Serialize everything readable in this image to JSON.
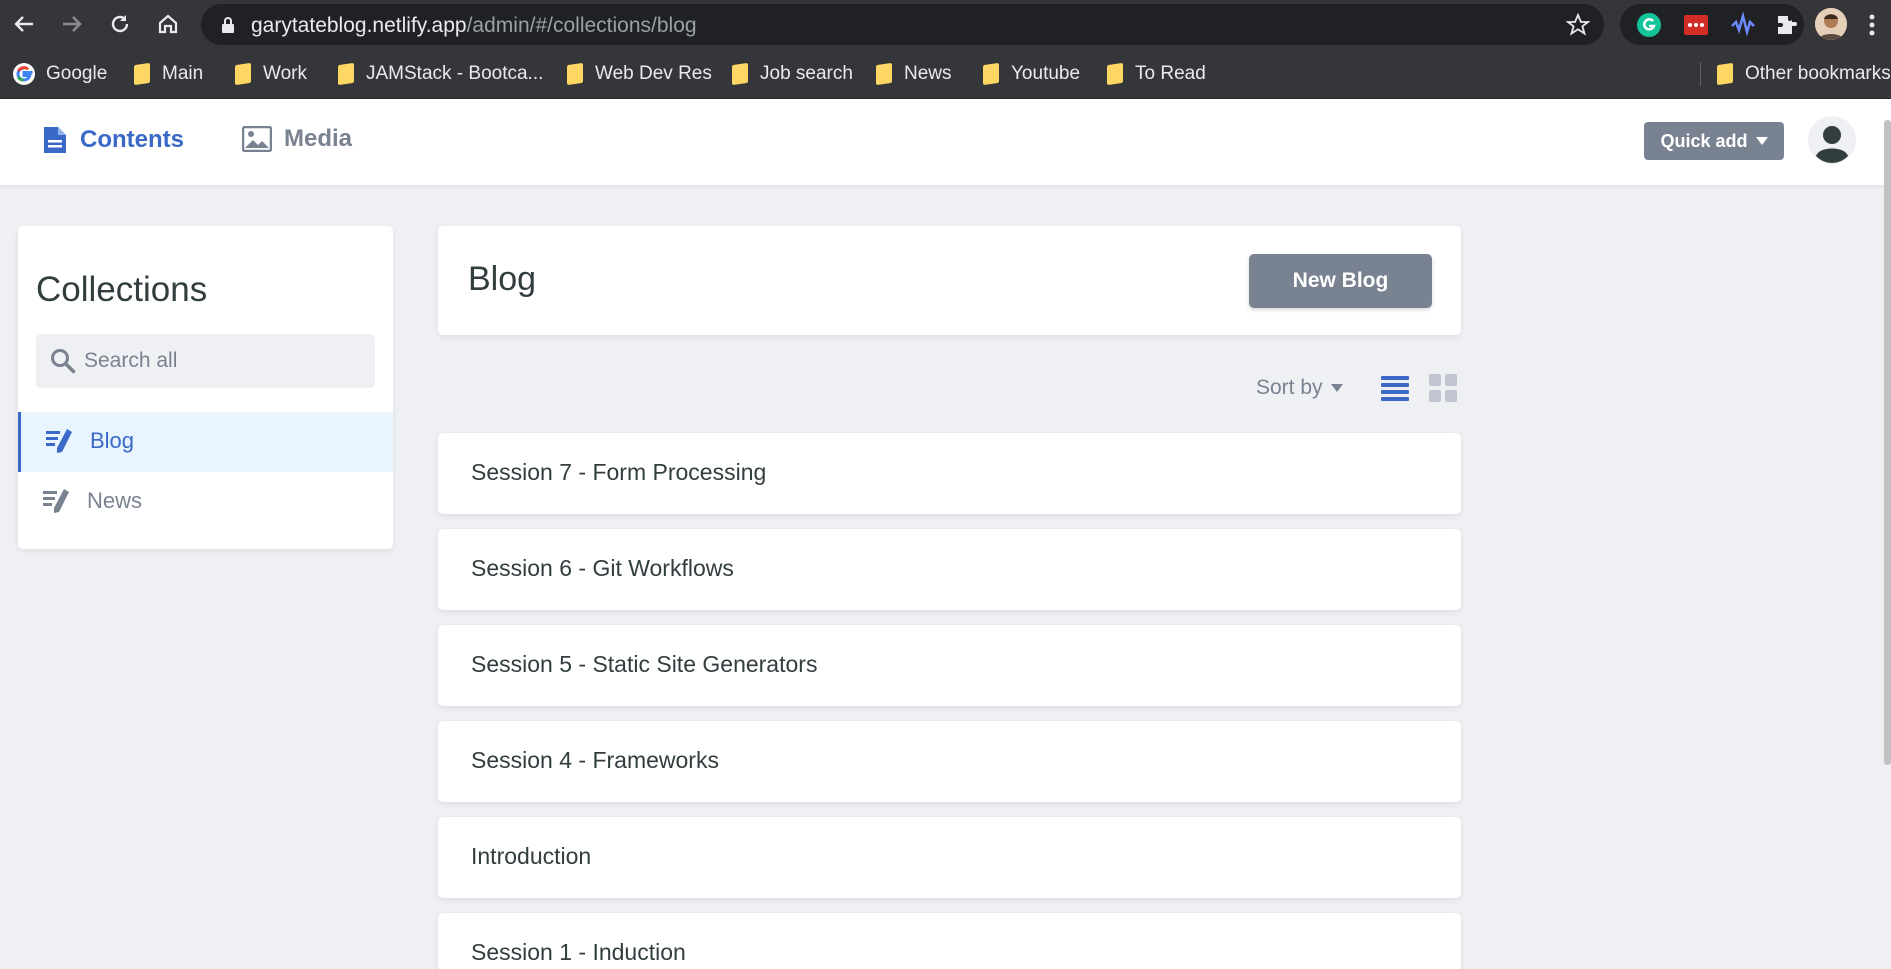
{
  "browser": {
    "url_host": "garytateblog.netlify.app",
    "url_path": "/admin/#/collections/blog",
    "bookmarks": [
      {
        "label": "Google",
        "icon": "google-icon"
      },
      {
        "label": "Main",
        "icon": "folder-icon"
      },
      {
        "label": "Work",
        "icon": "folder-icon"
      },
      {
        "label": "JAMStack - Bootca...",
        "icon": "folder-icon"
      },
      {
        "label": "Web Dev Res",
        "icon": "folder-icon"
      },
      {
        "label": "Job search",
        "icon": "folder-icon"
      },
      {
        "label": "News",
        "icon": "folder-icon"
      },
      {
        "label": "Youtube",
        "icon": "folder-icon"
      },
      {
        "label": "To Read",
        "icon": "folder-icon"
      }
    ],
    "other_bookmarks": "Other bookmarks"
  },
  "header": {
    "tabs": [
      {
        "label": "Contents",
        "icon": "document-icon",
        "active": true
      },
      {
        "label": "Media",
        "icon": "image-icon",
        "active": false
      }
    ],
    "quick_add": "Quick add"
  },
  "sidebar": {
    "title": "Collections",
    "search_placeholder": "Search all",
    "items": [
      {
        "label": "Blog",
        "icon": "write-icon",
        "active": true
      },
      {
        "label": "News",
        "icon": "write-icon",
        "active": false
      }
    ]
  },
  "main": {
    "collection_title": "Blog",
    "new_button": "New Blog",
    "sort_label": "Sort by",
    "entries": [
      "Session 7 - Form Processing",
      "Session 6 - Git Workflows",
      "Session 5 - Static Site Generators",
      "Session 4 - Frameworks",
      "Introduction",
      "Session 1 - Induction"
    ]
  },
  "colors": {
    "accent": "#3a69c7",
    "muted": "#798291",
    "background": "#eff0f4"
  }
}
